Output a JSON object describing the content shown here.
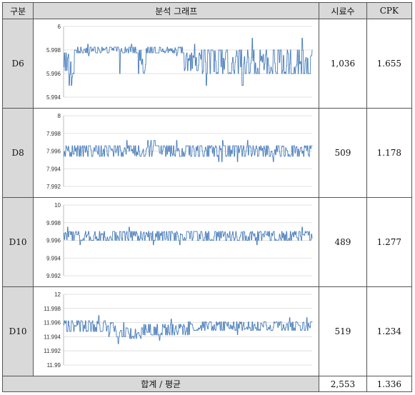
{
  "headers": {
    "category": "구분",
    "graph": "분석 그래프",
    "samples": "시료수",
    "cpk": "CPK"
  },
  "rows": [
    {
      "label": "D6",
      "samples": "1,036",
      "cpk": "1.655"
    },
    {
      "label": "D8",
      "samples": "509",
      "cpk": "1.178"
    },
    {
      "label": "D10",
      "samples": "489",
      "cpk": "1.277"
    },
    {
      "label": "D10",
      "samples": "519",
      "cpk": "1.234"
    }
  ],
  "footer": {
    "label": "합계 / 평균",
    "samples": "2,553",
    "cpk": "1.336"
  },
  "colors": {
    "line": "#4a7ebb",
    "header_bg": "#d9d9d9",
    "grid": "#d9d9d9"
  },
  "chart_data": [
    {
      "type": "line",
      "title": "",
      "xlabel": "",
      "ylabel": "",
      "ylim": [
        5.994,
        6
      ],
      "yticks": [
        "6",
        "5.998",
        "5.996",
        "5.994"
      ],
      "grid": true,
      "series": [
        {
          "profile": [
            [
              0,
              5.997,
              0.0015
            ],
            [
              0.02,
              5.996,
              0.002
            ],
            [
              0.04,
              5.997,
              0.002
            ],
            [
              0.05,
              5.998,
              0.0005
            ],
            [
              0.22,
              5.997,
              0.002
            ],
            [
              0.23,
              5.998,
              0.0005
            ],
            [
              0.3,
              5.997,
              0.002
            ],
            [
              0.33,
              5.998,
              0.0005
            ],
            [
              0.48,
              5.997,
              0.0015
            ],
            [
              0.55,
              5.997,
              0.002
            ],
            [
              1.0,
              5.997,
              0.002
            ]
          ]
        }
      ]
    },
    {
      "type": "line",
      "title": "",
      "xlabel": "",
      "ylabel": "",
      "ylim": [
        7.992,
        8
      ],
      "yticks": [
        "8",
        "7.998",
        "7.996",
        "7.994",
        "7.992"
      ],
      "grid": true,
      "series": [
        {
          "profile": [
            [
              0,
              7.996,
              0.0012
            ],
            [
              1.0,
              7.996,
              0.0012
            ]
          ]
        }
      ]
    },
    {
      "type": "line",
      "title": "",
      "xlabel": "",
      "ylabel": "",
      "ylim": [
        9.992,
        10
      ],
      "yticks": [
        "10",
        "9.998",
        "9.996",
        "9.994",
        "9.992"
      ],
      "grid": true,
      "series": [
        {
          "profile": [
            [
              0,
              9.9965,
              0.001
            ],
            [
              1.0,
              9.9965,
              0.001
            ]
          ]
        }
      ]
    },
    {
      "type": "line",
      "title": "",
      "xlabel": "",
      "ylabel": "",
      "ylim": [
        11.99,
        12
      ],
      "yticks": [
        "12",
        "11.998",
        "11.996",
        "11.994",
        "11.992",
        "11.99"
      ],
      "grid": true,
      "series": [
        {
          "profile": [
            [
              0,
              11.9955,
              0.0015
            ],
            [
              0.18,
              11.995,
              0.002
            ],
            [
              0.25,
              11.9945,
              0.0015
            ],
            [
              0.32,
              11.995,
              0.0015
            ],
            [
              0.5,
              11.9955,
              0.0012
            ],
            [
              1.0,
              11.9955,
              0.0012
            ]
          ]
        }
      ]
    }
  ]
}
